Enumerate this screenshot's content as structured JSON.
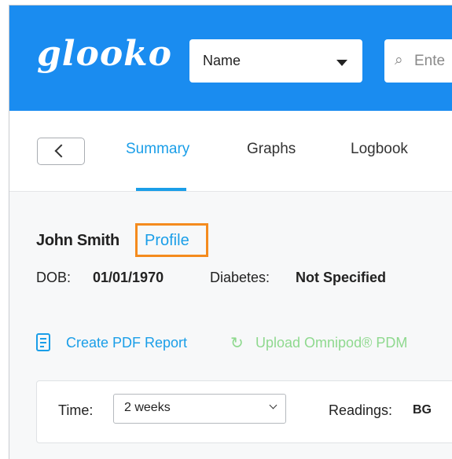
{
  "header": {
    "logo": "glooko",
    "name_select": "Name",
    "search_placeholder": "Ente",
    "search_icon": "search-icon",
    "background": "#1a8cf0"
  },
  "tabs": {
    "back_icon": "chevron-left-icon",
    "items": [
      {
        "label": "Summary",
        "active": true
      },
      {
        "label": "Graphs",
        "active": false
      },
      {
        "label": "Logbook",
        "active": false
      }
    ],
    "accent": "#1a9ee8"
  },
  "patient": {
    "name": "John Smith",
    "profile_link": "Profile",
    "dob_label": "DOB:",
    "dob_value": "01/01/1970",
    "diabetes_label": "Diabetes:",
    "diabetes_value": "Not Specified",
    "highlight_color": "#f48b1e"
  },
  "actions": {
    "pdf_icon": "document-icon",
    "pdf_label": "Create PDF Report",
    "upload_icon": "sync-icon",
    "upload_label": "Upload Omnipod® PDM",
    "upload_color": "#8fd98f"
  },
  "filters": {
    "time_label": "Time:",
    "time_value": "2 weeks",
    "readings_label": "Readings:",
    "readings_value": "BG"
  }
}
